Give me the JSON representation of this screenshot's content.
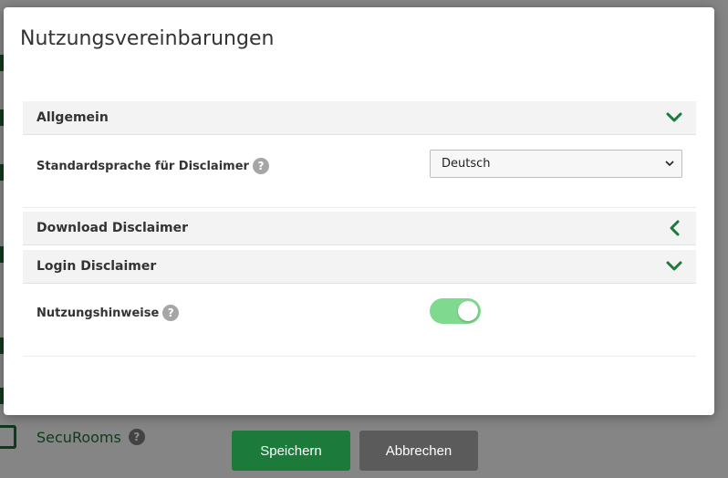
{
  "dialog": {
    "title": "Nutzungsvereinbarungen"
  },
  "sections": {
    "general": {
      "title": "Allgemein",
      "default_language_label": "Standardsprache für Disclaimer",
      "default_language_value": "Deutsch"
    },
    "download": {
      "title": "Download Disclaimer"
    },
    "login": {
      "title": "Login Disclaimer",
      "usage_notes_label": "Nutzungshinweise",
      "usage_notes_enabled": true
    }
  },
  "help_glyph": "?",
  "background": {
    "secu_rooms_label": "SecuRooms"
  },
  "buttons": {
    "save_label": "Speichern",
    "cancel_label": "Abbrechen"
  },
  "colors": {
    "accent": "#1c7a3a",
    "toggle_on": "#7fd98e",
    "cancel": "#5b5b5b"
  }
}
